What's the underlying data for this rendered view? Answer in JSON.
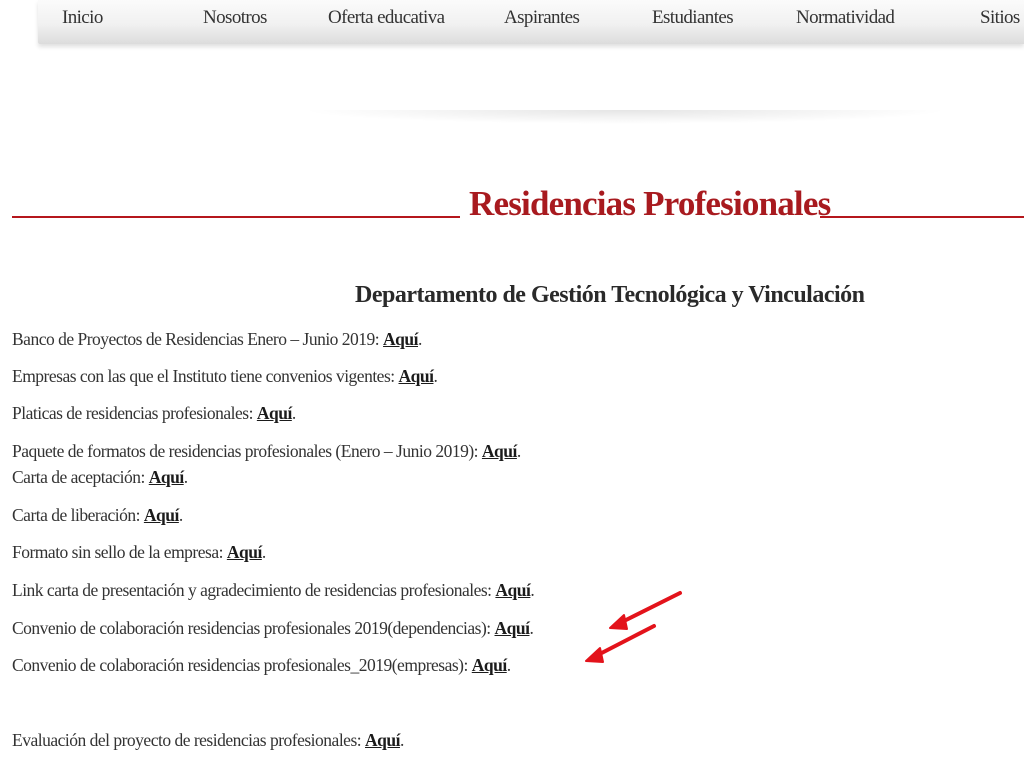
{
  "nav": {
    "items": [
      {
        "label": "Inicio"
      },
      {
        "label": "Nosotros"
      },
      {
        "label": "Oferta educativa"
      },
      {
        "label": "Aspirantes"
      },
      {
        "label": "Estudiantes"
      },
      {
        "label": "Normatividad"
      },
      {
        "label": "Sitios"
      }
    ]
  },
  "title": "Residencias Profesionales",
  "subtitle": "Departamento de Gestión Tecnológica y Vinculación",
  "link_text": "Aquí",
  "items": [
    {
      "text": "Banco de Proyectos de Residencias Enero – Junio 2019: ",
      "link": "Aquí",
      "suffix": "."
    },
    {
      "text": "Empresas con las que el Instituto tiene convenios vigentes: ",
      "link": "Aquí",
      "suffix": "."
    },
    {
      "text": "Platicas de residencias profesionales: ",
      "link": "Aquí",
      "suffix": "."
    },
    {
      "text": "Paquete de formatos de residencias profesionales (Enero – Junio 2019): ",
      "link": "Aquí",
      "suffix": "."
    },
    {
      "text": "Carta de aceptación: ",
      "link": "Aquí",
      "suffix": "."
    },
    {
      "text": "Carta de liberación: ",
      "link": "Aquí",
      "suffix": "."
    },
    {
      "text": "Formato sin sello de la empresa: ",
      "link": "Aquí",
      "suffix": "."
    },
    {
      "text": "Link carta de presentación y agradecimiento de residencias profesionales: ",
      "link": "Aquí",
      "suffix": "."
    },
    {
      "text": "Convenio de colaboración residencias profesionales 2019(dependencias): ",
      "link": "Aquí",
      "suffix": "."
    },
    {
      "text": "Convenio de colaboración residencias profesionales_2019(empresas): ",
      "link": "Aquí",
      "suffix": "."
    },
    {
      "text": "Evaluación del proyecto de residencias profesionales: ",
      "link": "Aquí",
      "suffix": "."
    }
  ],
  "colors": {
    "title": "#a81a1f",
    "title_rule": "#b5161c",
    "annotation_arrow": "#e3131b"
  },
  "icons": {
    "annotation": "red-arrow-icon"
  }
}
